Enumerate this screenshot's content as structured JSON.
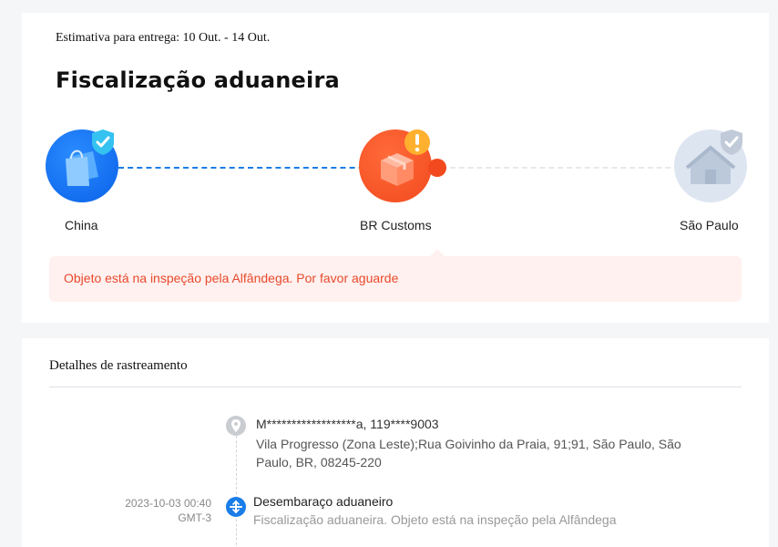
{
  "delivery": {
    "estimate": "Estimativa para entrega: 10 Out. - 14 Out.",
    "status_title": "Fiscalização aduaneira"
  },
  "progress": {
    "nodes": [
      {
        "label": "China",
        "icon": "shopping-bag-icon",
        "badge": "check-shield-icon",
        "state": "done"
      },
      {
        "label": "BR Customs",
        "icon": "package-box-icon",
        "badge": "warning-icon",
        "state": "current"
      },
      {
        "label": "São Paulo",
        "icon": "house-icon",
        "badge": "check-shield-icon",
        "state": "pending"
      }
    ],
    "colors": {
      "done": "#1a7de8",
      "current": "#f24a1e",
      "pending": "#dde5f1",
      "warning": "#ffb02e"
    }
  },
  "alert": {
    "text": "Objeto está na inspeção pela Alfândega. Por favor aguarde"
  },
  "details": {
    "title": "Detalhes de rastreamento",
    "address": {
      "icon": "location-pin-icon",
      "line1": "M******************a,  119****9003",
      "line2": "Vila Progresso (Zona Leste);Rua Goivinho da Praia, 91;91,  São Paulo,  São Paulo,  BR,  08245-220"
    },
    "events": [
      {
        "date": "2023-10-03 00:40",
        "timezone": "GMT-3",
        "icon": "customs-clearance-icon",
        "title": "Desembaraço aduaneiro",
        "description": "Fiscalização aduaneira. Objeto está na inspeção pela Alfândega"
      }
    ]
  }
}
